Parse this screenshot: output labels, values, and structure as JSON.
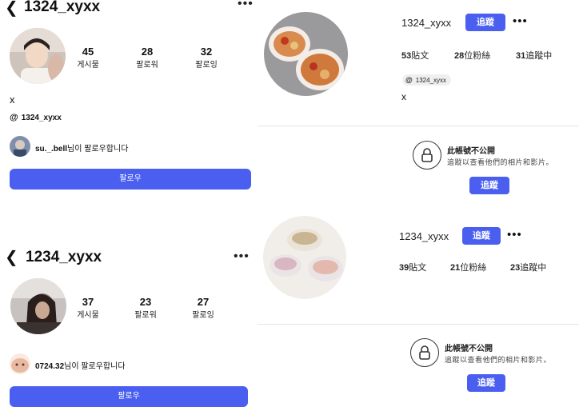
{
  "panel1": {
    "username": "1324_xyxx",
    "stats": [
      {
        "value": "45",
        "label": "게시물"
      },
      {
        "value": "28",
        "label": "팔로워"
      },
      {
        "value": "32",
        "label": "팔로잉"
      }
    ],
    "bio": "x",
    "threads_handle": "1324_xyxx",
    "followed_by_name": "su._.bell",
    "followed_by_suffix": "님이 팔로우합니다",
    "follow_button": "팔로우"
  },
  "panel2": {
    "username": "1234_xyxx",
    "stats": [
      {
        "value": "37",
        "label": "게시물"
      },
      {
        "value": "23",
        "label": "팔로워"
      },
      {
        "value": "27",
        "label": "팔로잉"
      }
    ],
    "followed_by_name": "0724.32",
    "followed_by_suffix": "님이 팔로우합니다",
    "follow_button": "팔로우"
  },
  "panel3": {
    "username": "1324_xyxx",
    "follow_button": "追蹤",
    "posts": "53",
    "posts_label": "貼文",
    "followers": "28",
    "followers_label": "位粉絲",
    "following": "31",
    "following_label": "追蹤中",
    "threads_handle": "1324_xyxx",
    "bio": "x",
    "private_title": "此帳號不公開",
    "private_sub": "追蹤以查看他們的相片和影片。",
    "private_button": "追蹤"
  },
  "panel4": {
    "username": "1234_xyxx",
    "follow_button": "追蹤",
    "posts": "39",
    "posts_label": "貼文",
    "followers": "21",
    "followers_label": "位粉絲",
    "following": "23",
    "following_label": "追蹤中",
    "private_title": "此帳號不公開",
    "private_sub": "追蹤以查看他們的相片和影片。",
    "private_button": "追蹤"
  },
  "colors": {
    "accent": "#4a5ef0",
    "chip": "#efefef"
  }
}
